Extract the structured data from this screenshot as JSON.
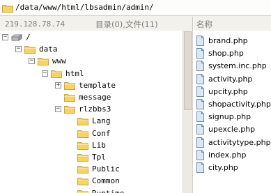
{
  "path": "/data/www/html/lbsadmin/admin/",
  "header": {
    "ip": "219.128.78.74",
    "summary": "目录(0),文件(11)",
    "name_col": "名称"
  },
  "tree": [
    {
      "label": "/",
      "icon": "drive-icon",
      "level": 0,
      "expander": "minus"
    },
    {
      "label": "data",
      "icon": "folder-icon",
      "level": 1,
      "expander": "minus"
    },
    {
      "label": "www",
      "icon": "folder-icon",
      "level": 2,
      "expander": "minus"
    },
    {
      "label": "html",
      "icon": "folder-icon",
      "level": 3,
      "expander": "minus"
    },
    {
      "label": "template",
      "icon": "folder-icon",
      "level": 4,
      "expander": "plus"
    },
    {
      "label": "message",
      "icon": "folder-icon",
      "level": 4,
      "expander": "none"
    },
    {
      "label": "rlzbbs3",
      "icon": "folder-icon",
      "level": 4,
      "expander": "minus"
    },
    {
      "label": "Lang",
      "icon": "folder-icon",
      "level": 5,
      "expander": "none"
    },
    {
      "label": "Conf",
      "icon": "folder-icon",
      "level": 5,
      "expander": "none"
    },
    {
      "label": "Lib",
      "icon": "folder-icon",
      "level": 5,
      "expander": "none"
    },
    {
      "label": "Tpl",
      "icon": "folder-icon",
      "level": 5,
      "expander": "none"
    },
    {
      "label": "Public",
      "icon": "folder-icon",
      "level": 5,
      "expander": "none"
    },
    {
      "label": "Common",
      "icon": "folder-icon",
      "level": 5,
      "expander": "none"
    },
    {
      "label": "Runtime",
      "icon": "folder-icon",
      "level": 5,
      "expander": "none"
    }
  ],
  "files": [
    "brand.php",
    "shop.php",
    "system.inc.php",
    "activity.php",
    "upcity.php",
    "shopactivity.php",
    "signup.php",
    "upexcle.php",
    "activitytype.php",
    "index.php",
    "city.php"
  ],
  "colors": {
    "folder": "#f5d36a",
    "folder_edge": "#c9a43c",
    "file": "#dbe7f5",
    "file_edge": "#6b88ad"
  }
}
